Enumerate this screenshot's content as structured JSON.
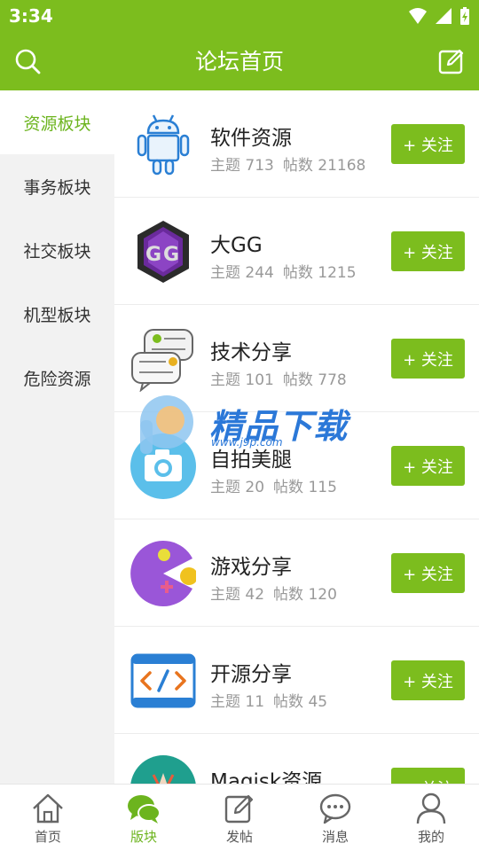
{
  "status": {
    "time": "3:34"
  },
  "header": {
    "title": "论坛首页"
  },
  "sidebar": {
    "items": [
      {
        "label": "资源板块",
        "active": true
      },
      {
        "label": "事务板块",
        "active": false
      },
      {
        "label": "社交板块",
        "active": false
      },
      {
        "label": "机型板块",
        "active": false
      },
      {
        "label": "危险资源",
        "active": false
      }
    ]
  },
  "forums": [
    {
      "name": "软件资源",
      "topics_label": "主题 713",
      "posts_label": "帖数 21168",
      "follow": "+ 关注",
      "icon": "android-icon"
    },
    {
      "name": "大GG",
      "topics_label": "主题 244",
      "posts_label": "帖数 1215",
      "follow": "+ 关注",
      "icon": "gg-logo-icon"
    },
    {
      "name": "技术分享",
      "topics_label": "主题 101",
      "posts_label": "帖数 778",
      "follow": "+ 关注",
      "icon": "chat-bubbles-icon"
    },
    {
      "name": "自拍美腿",
      "topics_label": "主题 20",
      "posts_label": "帖数 115",
      "follow": "+ 关注",
      "icon": "camera-icon"
    },
    {
      "name": "游戏分享",
      "topics_label": "主题 42",
      "posts_label": "帖数 120",
      "follow": "+ 关注",
      "icon": "pacman-game-icon"
    },
    {
      "name": "开源分享",
      "topics_label": "主题 11",
      "posts_label": "帖数 45",
      "follow": "+ 关注",
      "icon": "code-icon"
    },
    {
      "name": "Magisk资源",
      "topics_label": "",
      "posts_label": "",
      "follow": "+ 关注",
      "icon": "magisk-icon"
    }
  ],
  "watermark": {
    "text": "精品下载",
    "url": "www.j9p.com"
  },
  "bottom_nav": {
    "items": [
      {
        "label": "首页",
        "icon": "home-icon"
      },
      {
        "label": "版块",
        "icon": "chat-bubble-icon",
        "active": true
      },
      {
        "label": "发帖",
        "icon": "compose-icon"
      },
      {
        "label": "消息",
        "icon": "message-icon"
      },
      {
        "label": "我的",
        "icon": "user-icon"
      }
    ]
  },
  "colors": {
    "accent": "#7cbd1e",
    "active_text": "#6cb41e"
  }
}
